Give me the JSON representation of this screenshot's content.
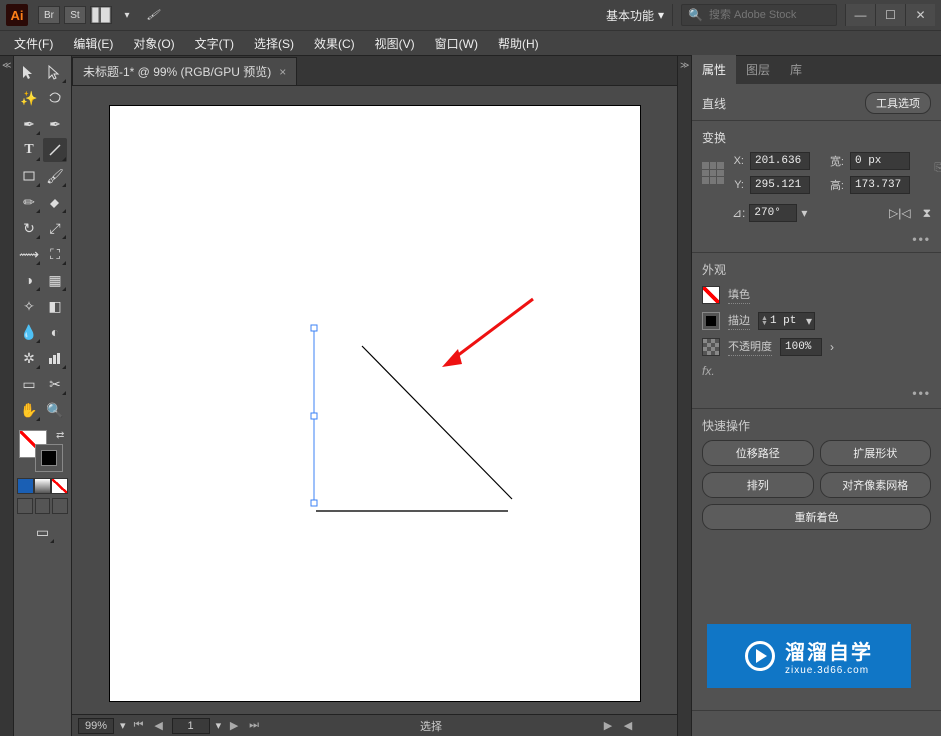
{
  "app": {
    "logo": "Ai"
  },
  "titlebar": {
    "br": "Br",
    "st": "St",
    "workspace": "基本功能",
    "search_placeholder": "搜索 Adobe Stock"
  },
  "menu": {
    "file": "文件(F)",
    "edit": "编辑(E)",
    "object": "对象(O)",
    "text": "文字(T)",
    "select": "选择(S)",
    "effect": "效果(C)",
    "view": "视图(V)",
    "window": "窗口(W)",
    "help": "帮助(H)"
  },
  "doc": {
    "tab_title": "未标题-1* @ 99% (RGB/GPU 预览)"
  },
  "status": {
    "zoom": "99%",
    "page": "1",
    "mode": "选择"
  },
  "panels": {
    "tabs": {
      "properties": "属性",
      "layers": "图层",
      "libraries": "库"
    },
    "selection_type": "直线",
    "tool_options_btn": "工具选项",
    "transform": {
      "title": "变换",
      "x_label": "X:",
      "x": "201.636",
      "y_label": "Y:",
      "y": "295.121",
      "w_label": "宽:",
      "w": "0 px",
      "h_label": "高:",
      "h": "173.737",
      "rot_label": "⊿:",
      "rotation": "270°"
    },
    "appearance": {
      "title": "外观",
      "fill_label": "填色",
      "stroke_label": "描边",
      "stroke_weight": "1 pt",
      "opacity_label": "不透明度",
      "opacity": "100%",
      "fx_label": "fx."
    },
    "quick": {
      "title": "快速操作",
      "offset_path": "位移路径",
      "expand_shape": "扩展形状",
      "arrange": "排列",
      "align_pixel": "对齐像素网格",
      "recolor": "重新着色"
    }
  },
  "watermark": {
    "line1": "溜溜自学",
    "line2": "zixue.3d66.com"
  },
  "chart_data": {
    "type": "line",
    "note": "Artboard contains a selected vertical line segment, a diagonal black line, a horizontal dark line, and a red arrow annotation.",
    "selected_object": {
      "kind": "line",
      "x": 201.636,
      "y": 295.121,
      "width": 0,
      "height": 173.737,
      "rotation_deg": 270
    }
  }
}
